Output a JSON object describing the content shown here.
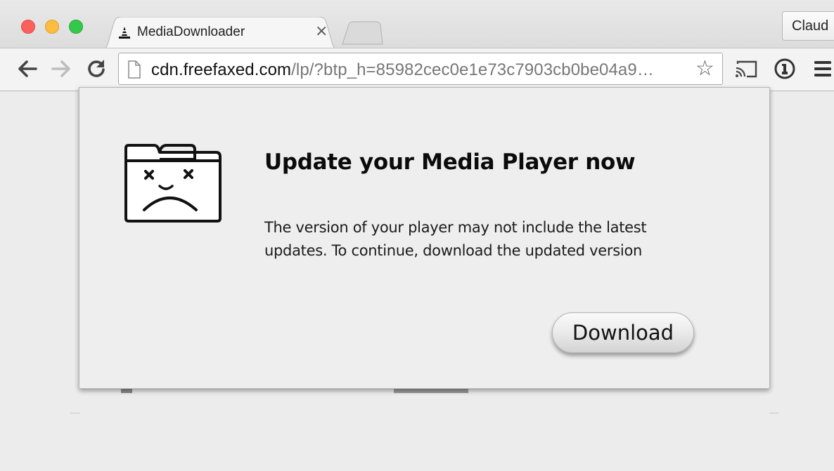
{
  "browser": {
    "tab": {
      "title": "MediaDownloader",
      "favicon": "vlc-cone-icon",
      "close_glyph": "×"
    },
    "profile_button_label": "Claud",
    "toolbar": {
      "back_icon": "back-arrow-icon",
      "forward_icon": "forward-arrow-icon",
      "reload_icon": "reload-icon",
      "cast_icon": "cast-icon",
      "extension_icon": "extension-icon",
      "menu_icon": "menu-icon"
    },
    "omnibox": {
      "url_host": "cdn.freefaxed.com",
      "url_rest": "/lp/?btp_h=85982cec0e1e73c7903cb0be04a9…",
      "star_glyph": "☆"
    }
  },
  "dialog": {
    "icon": "sad-folder-icon",
    "heading": "Update your Media Player now",
    "message": "The version of your player may not include the latest updates. To continue, download the updated version",
    "button_label": "Download"
  },
  "colors": {
    "close_light": "#fc605c",
    "minimize_light": "#fdbc40",
    "zoom_light": "#34c84a",
    "content_background": "#ececec"
  }
}
